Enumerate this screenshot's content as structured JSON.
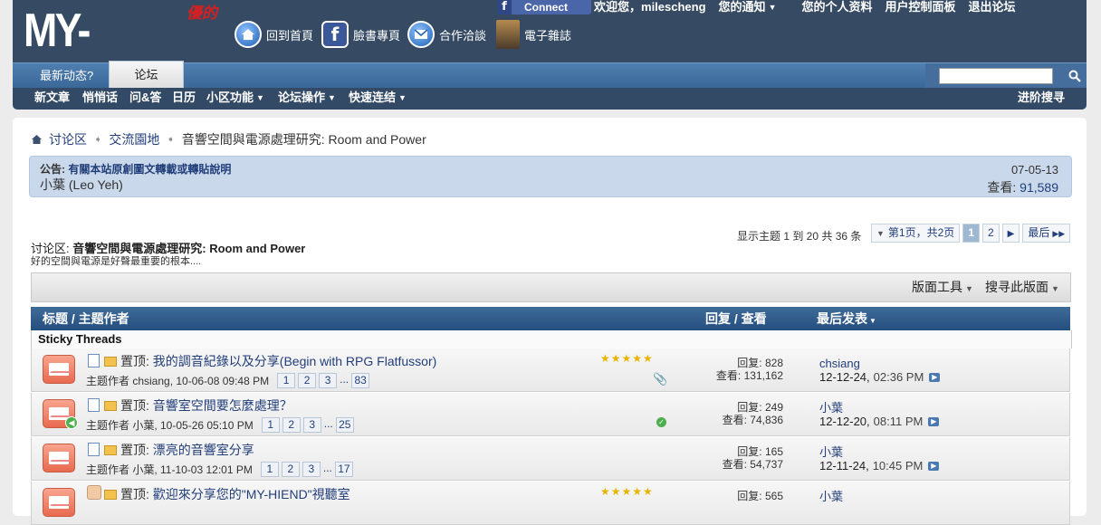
{
  "header": {
    "logo_text": "MY-HIEND",
    "logo_badge": "優的",
    "nav": [
      {
        "label": "回到首頁",
        "icon": "home-icon"
      },
      {
        "label": "臉書專頁",
        "icon": "facebook-icon"
      },
      {
        "label": "合作洽談",
        "icon": "mail-icon"
      },
      {
        "label": "電子雜誌",
        "icon": "magazine-icon"
      }
    ],
    "fb_connect": "Connect",
    "welcome": "欢迎您，",
    "username": "milescheng",
    "notifications": "您的通知",
    "profile": "您的个人资料",
    "control_panel": "用户控制面板",
    "logout": "退出论坛"
  },
  "tabs": {
    "whats_new": "最新动态?",
    "forum": "论坛"
  },
  "search": {
    "placeholder": ""
  },
  "navlinks": {
    "new_posts": "新文章",
    "private": "悄悄话",
    "faq": "问&答",
    "calendar": "日历",
    "community": "小区功能",
    "forum_actions": "论坛操作",
    "quick_links": "快速连结",
    "advanced_search": "进阶搜寻"
  },
  "breadcrumb": {
    "root": "讨论区",
    "parent": "交流園地",
    "current": "音響空間與電源處理研究: Room and Power"
  },
  "notice": {
    "label": "公告:",
    "title": "有關本站原創圖文轉載或轉貼說明",
    "author": "小葉 (Leo Yeh)",
    "date": "07-05-13",
    "views_label": "查看:",
    "views": "91,589"
  },
  "pagination": {
    "info": "显示主题 1 到 20 共 36 条",
    "label": "第1页，共2页",
    "page1": "1",
    "page2": "2",
    "last": "最后"
  },
  "forum": {
    "title_prefix": "讨论区:",
    "title": "音響空間與電源處理研究: Room and Power",
    "description": "好的空間與電源是好聲最重要的根本...."
  },
  "tools": {
    "forum_tools": "版面工具",
    "search_forum": "搜寻此版面"
  },
  "table": {
    "col_title": "标题 / 主题作者",
    "col_stats": "回复 / 查看",
    "col_last": "最后发表",
    "sticky_label": "Sticky Threads"
  },
  "threads": [
    {
      "prefix": "置顶:",
      "title": "我的調音紀錄以及分享(Begin with RPG Flatfussor)",
      "meta": "主题作者 chsiang, 10-06-08 09:48 PM",
      "pages": [
        "1",
        "2",
        "3",
        "...",
        "83"
      ],
      "stars": "★★★★★",
      "replies_label": "回复:",
      "replies": "828",
      "views_label": "查看:",
      "views": "131,162",
      "last_user": "chsiang",
      "last_date": "12-12-24,",
      "last_time": "02:36 PM"
    },
    {
      "prefix": "置顶:",
      "title": "音響室空間要怎麼處理？",
      "meta": "主题作者 小葉, 10-05-26 05:10 PM",
      "pages": [
        "1",
        "2",
        "3",
        "...",
        "25"
      ],
      "stars": "",
      "replies_label": "回复:",
      "replies": "249",
      "views_label": "查看:",
      "views": "74,836",
      "last_user": "小葉",
      "last_date": "12-12-20,",
      "last_time": "08:11 PM"
    },
    {
      "prefix": "置顶:",
      "title": "漂亮的音響室分享",
      "meta": "主题作者 小葉, 11-10-03 12:01 PM",
      "pages": [
        "1",
        "2",
        "3",
        "...",
        "17"
      ],
      "stars": "",
      "replies_label": "回复:",
      "replies": "165",
      "views_label": "查看:",
      "views": "54,737",
      "last_user": "小葉",
      "last_date": "12-11-24,",
      "last_time": "10:45 PM"
    },
    {
      "prefix": "置顶:",
      "title": "歡迎來分享您的\"MY-HIEND\"視聽室",
      "meta": "",
      "pages": [],
      "stars": "★★★★★",
      "replies_label": "回复:",
      "replies": "565",
      "views_label": "",
      "views": "",
      "last_user": "小葉",
      "last_date": "",
      "last_time": ""
    }
  ],
  "colors": {
    "header_bg": "#364b63",
    "nav_bg": "#3a6898",
    "table_header": "#254e7d",
    "link": "#223e7a"
  }
}
